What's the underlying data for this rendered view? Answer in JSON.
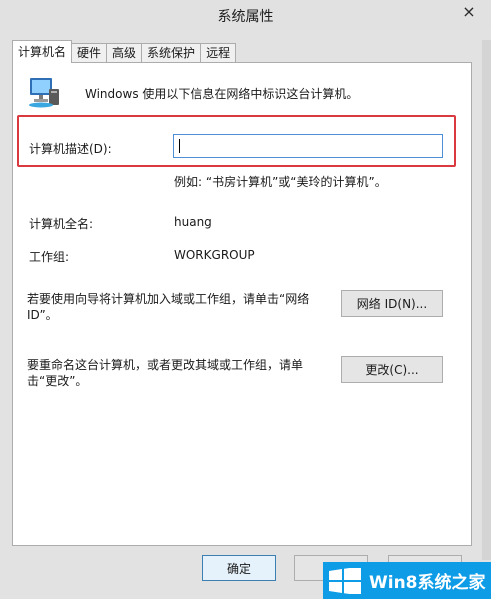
{
  "window": {
    "title": "系统属性",
    "close_icon": "×"
  },
  "tabs": [
    {
      "label": "计算机名",
      "active": true
    },
    {
      "label": "硬件",
      "active": false
    },
    {
      "label": "高级",
      "active": false
    },
    {
      "label": "系统保护",
      "active": false
    },
    {
      "label": "远程",
      "active": false
    }
  ],
  "computer_name_tab": {
    "intro": "Windows 使用以下信息在网络中标识这台计算机。",
    "description_label": "计算机描述(D):",
    "description_value": "",
    "example": "例如: “书房计算机”或“美玲的计算机”。",
    "full_name_label": "计算机全名:",
    "full_name_value": "huang",
    "workgroup_label": "工作组:",
    "workgroup_value": "WORKGROUP",
    "network_id_text": "若要使用向导将计算机加入域或工作组，请单击“网络 ID”。",
    "network_id_button": "网络 ID(N)...",
    "rename_text": "要重命名这台计算机，或者更改其域或工作组，请单击“更改”。",
    "change_button": "更改(C)..."
  },
  "footer": {
    "ok_button": "确定",
    "cancel_button": "",
    "apply_button": ""
  },
  "watermark": {
    "text": "Win8系统之家"
  },
  "colors": {
    "highlight": "#d9393f",
    "watermark_bg": "#0f9ce6",
    "input_border": "#4f8fd7"
  }
}
